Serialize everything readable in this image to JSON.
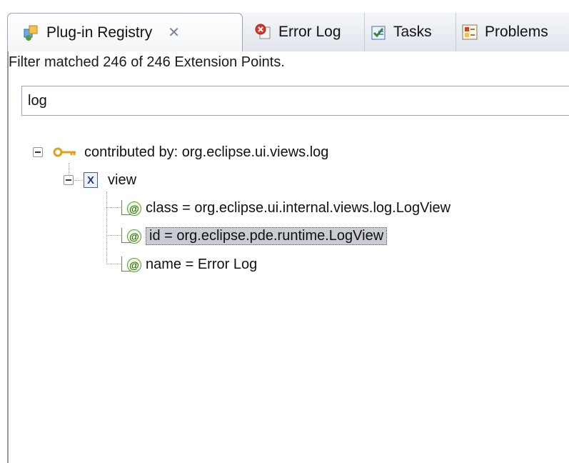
{
  "tabs": [
    {
      "label": "Plug-in Registry",
      "icon": "plugin-registry-icon",
      "active": true,
      "close_glyph": "✕"
    },
    {
      "label": "Error Log",
      "icon": "error-log-icon",
      "active": false
    },
    {
      "label": "Tasks",
      "icon": "tasks-icon",
      "active": false
    },
    {
      "label": "Problems",
      "icon": "problems-icon",
      "active": false
    }
  ],
  "status_text": "Filter matched 246 of 246 Extension Points.",
  "filter": {
    "value": "log",
    "placeholder": ""
  },
  "tree": {
    "root_label": "contributed by: org.eclipse.ui.views.log",
    "child_label": "view",
    "child_icon_text": "X",
    "attr_icon_text": "@",
    "attributes": [
      {
        "label": "class = org.eclipse.ui.internal.views.log.LogView",
        "selected": false
      },
      {
        "label": "id = org.eclipse.pde.runtime.LogView",
        "selected": true
      },
      {
        "label": "name = Error Log",
        "selected": false
      }
    ]
  },
  "colors": {
    "selection_bg": "#c9ccd2",
    "tab_bar_bg": "#e1e5ec",
    "key_icon": "#e0a020",
    "error_icon": "#d93a2b"
  }
}
